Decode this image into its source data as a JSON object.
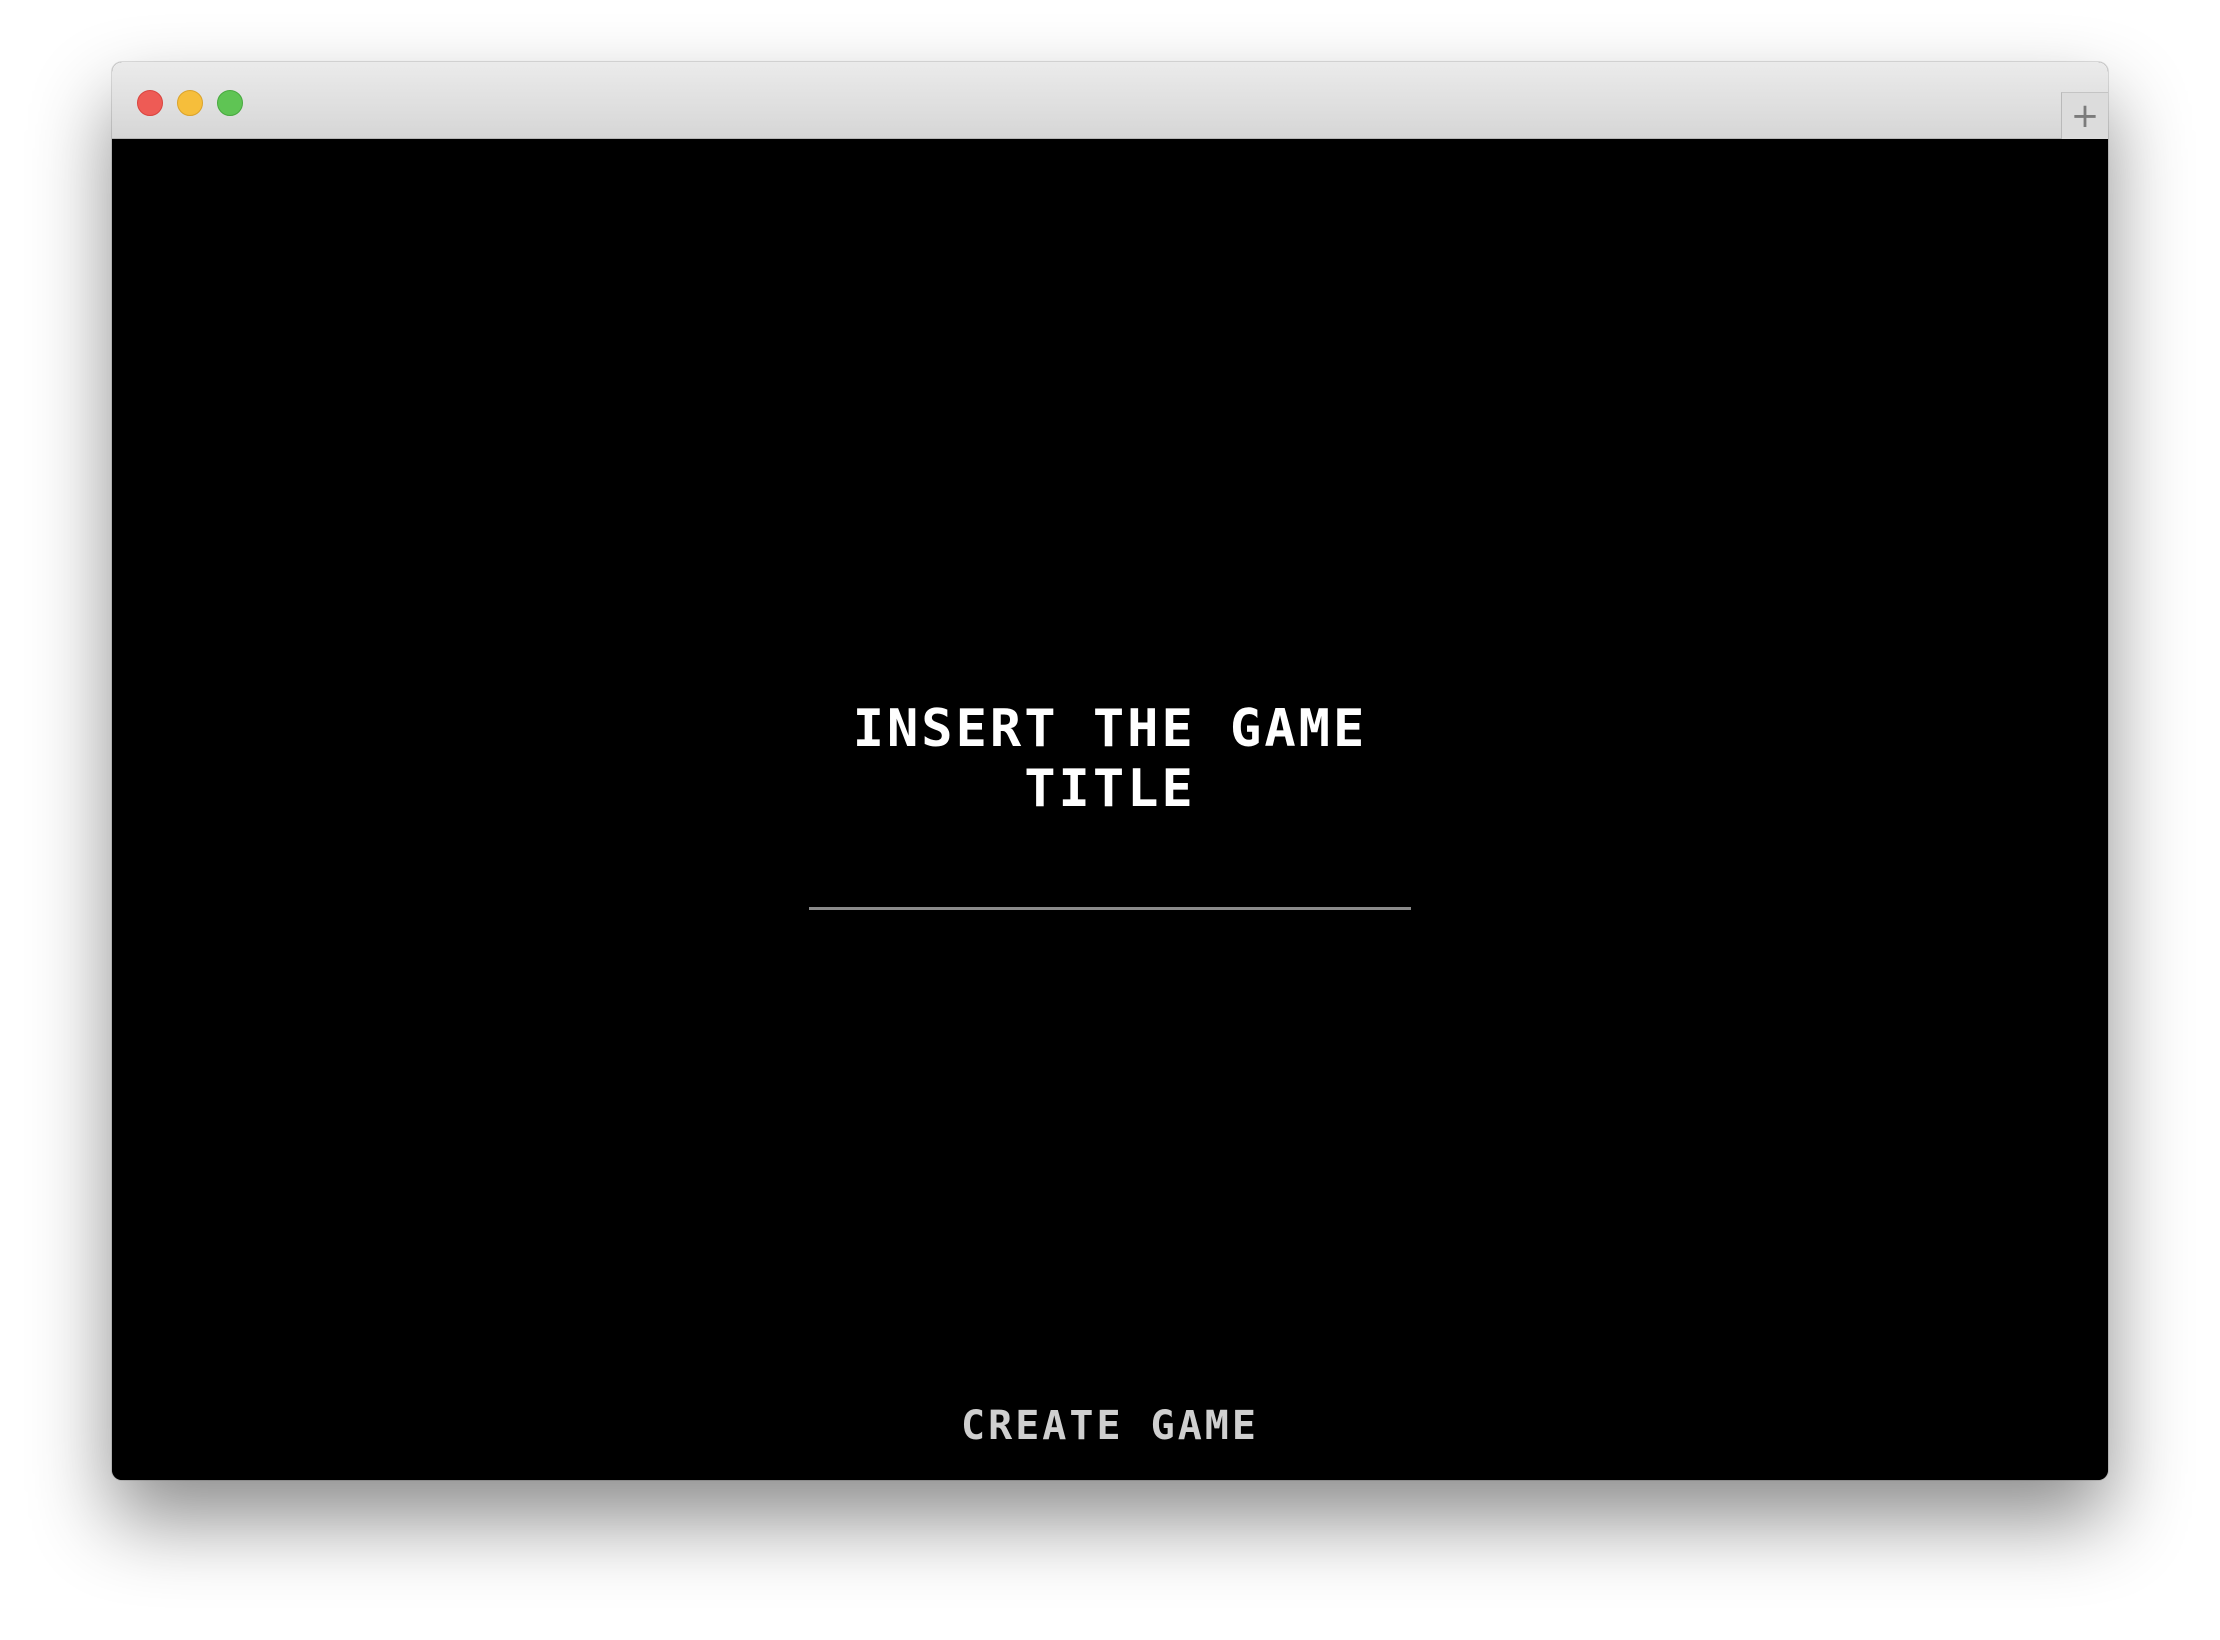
{
  "window": {
    "controls": [
      "close",
      "minimize",
      "zoom"
    ],
    "new_tab_icon": "plus-icon",
    "new_tab_glyph": "+"
  },
  "game": {
    "title_line1": "INSERT THE GAME",
    "title_line2": "TITLE",
    "create_button_label": "CREATE GAME"
  },
  "colors": {
    "background": "#000000",
    "title_text": "#ffffff",
    "button_text": "#cfcfcf",
    "underline": "#8a8a8a"
  }
}
